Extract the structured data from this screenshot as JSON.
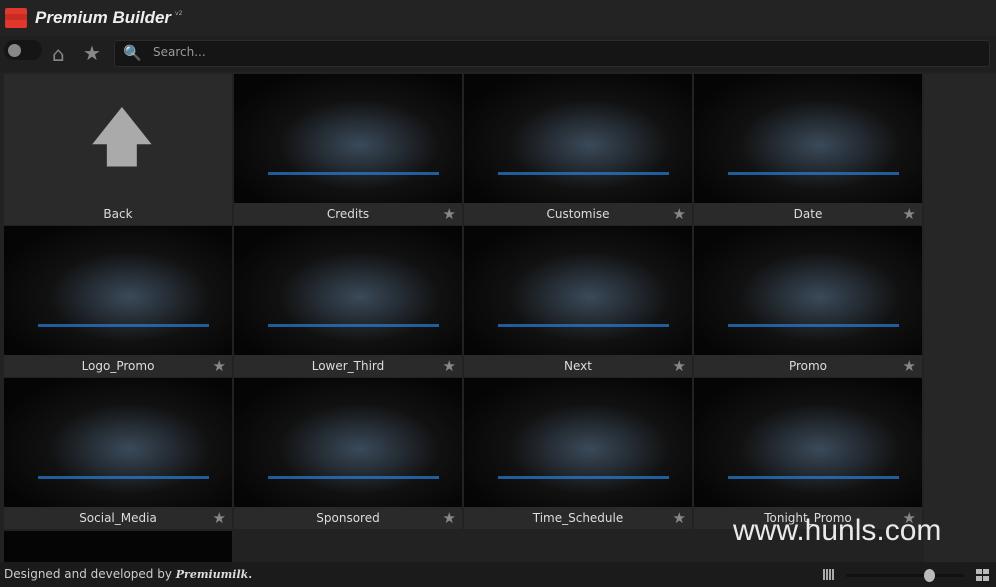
{
  "app": {
    "title": "Premium Builder",
    "version": "v2"
  },
  "toolbar": {
    "search_placeholder": "Search..."
  },
  "items": [
    {
      "label": "Back"
    },
    {
      "label": "Credits"
    },
    {
      "label": "Customise"
    },
    {
      "label": "Date"
    },
    {
      "label": "Logo_Promo"
    },
    {
      "label": "Lower_Third"
    },
    {
      "label": "Next"
    },
    {
      "label": "Promo"
    },
    {
      "label": "Social_Media"
    },
    {
      "label": "Sponsored"
    },
    {
      "label": "Time_Schedule"
    },
    {
      "label": "Tonight_Promo"
    }
  ],
  "footer": {
    "text": "Designed and developed by",
    "signature": "Premiumilk.",
    "zoom_slider_value": 0.75
  },
  "watermark": "www.hunls.com"
}
